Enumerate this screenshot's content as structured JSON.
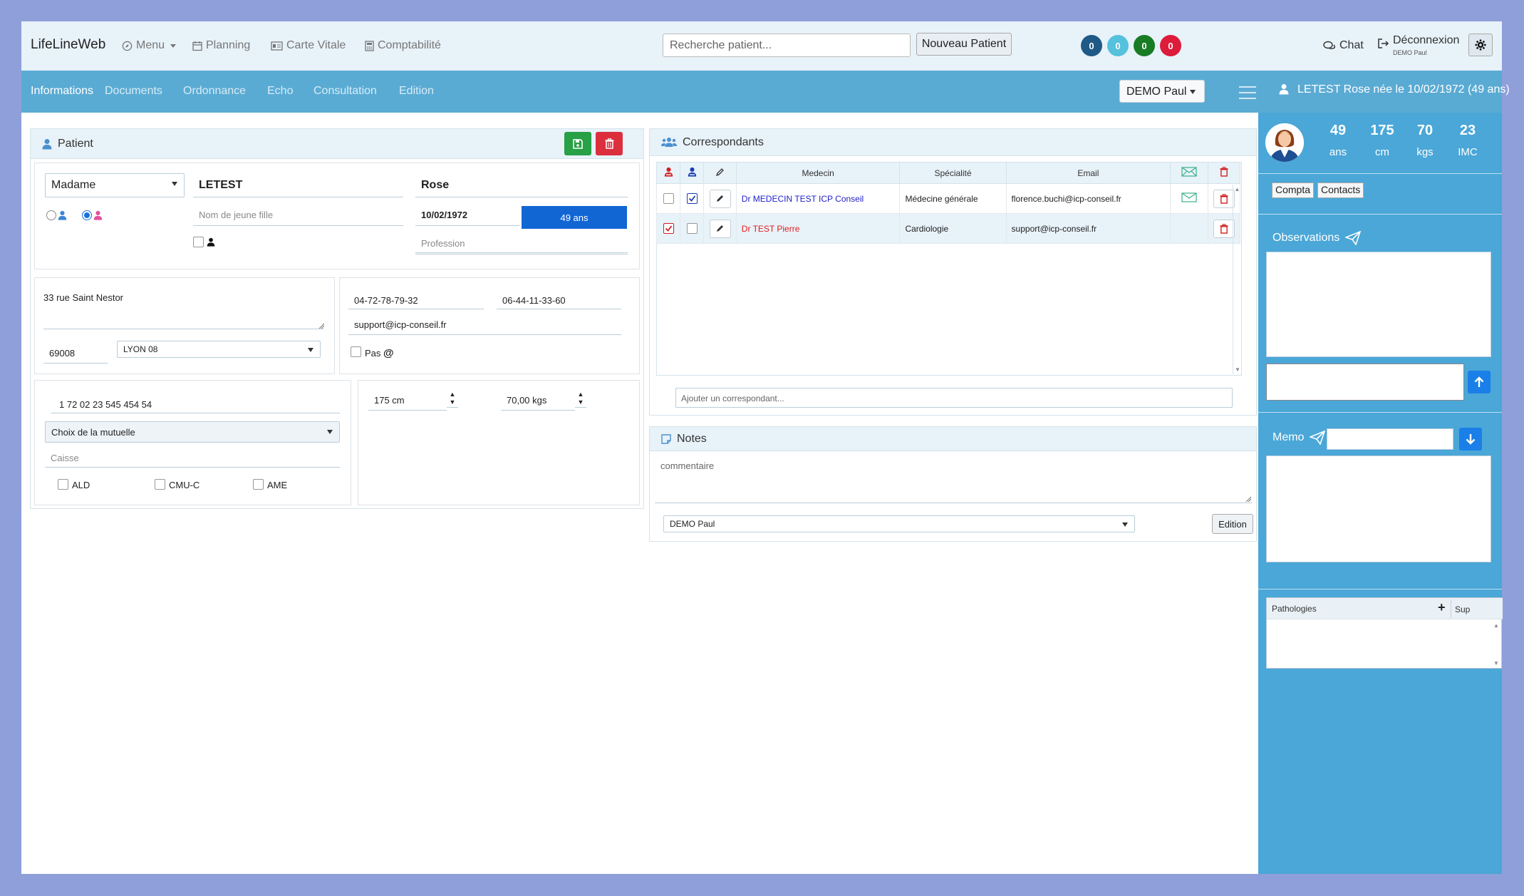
{
  "app": {
    "brand": "LifeLineWeb"
  },
  "topnav": {
    "menu": "Menu",
    "planning": "Planning",
    "carte_vitale": "Carte Vitale",
    "comptabilite": "Comptabilité",
    "search_placeholder": "Recherche patient...",
    "new_patient": "Nouveau Patient",
    "badges": [
      {
        "value": "0",
        "color": "#1f5a87"
      },
      {
        "value": "0",
        "color": "#55c1dd"
      },
      {
        "value": "0",
        "color": "#187c24"
      },
      {
        "value": "0",
        "color": "#dd1b3a"
      }
    ],
    "chat": "Chat",
    "logout": "Déconnexion",
    "logout_user": "DEMO Paul"
  },
  "tabs": [
    "Informations",
    "Documents",
    "Ordonnance",
    "Echo",
    "Consultation",
    "Edition"
  ],
  "doctor_select": "DEMO Paul",
  "patient_header": "LETEST Rose née le 10/02/1972 (49 ans)",
  "patient_panel": {
    "title": "Patient",
    "civility": "Madame",
    "last_name": "LETEST",
    "first_name": "Rose",
    "maiden_name_placeholder": "Nom de jeune fille",
    "birth_date": "10/02/1972",
    "age": "49 ans",
    "profession_placeholder": "Profession",
    "address": "33 rue Saint Nestor",
    "postal_code": "69008",
    "city": "LYON 08",
    "phone1": "04-72-78-79-32",
    "phone2": "06-44-11-33-60",
    "email": "support@icp-conseil.fr",
    "no_email_label": "Pas",
    "at_symbol": "@",
    "ssn": "1 72 02 23 545 454 54",
    "mutuelle": "Choix de la mutuelle",
    "caisse_placeholder": "Caisse",
    "flags": [
      "ALD",
      "CMU-C",
      "AME"
    ],
    "height": "175 cm",
    "weight": "70,00 kgs"
  },
  "correspondants": {
    "title": "Correspondants",
    "columns": [
      "Medecin",
      "Spécialité",
      "Email"
    ],
    "rows": [
      {
        "name": "Dr MEDECIN TEST ICP Conseil",
        "specialty": "Médecine générale",
        "email": "florence.buchi@icp-conseil.fr",
        "color": "#2222cc"
      },
      {
        "name": "Dr TEST Pierre",
        "specialty": "Cardiologie",
        "email": "support@icp-conseil.fr",
        "color": "#e02020"
      }
    ],
    "add_placeholder": "Ajouter un correspondant..."
  },
  "notes": {
    "title": "Notes",
    "comment_placeholder": "commentaire",
    "doctor": "DEMO Paul",
    "edition_button": "Edition"
  },
  "sidebar": {
    "stats": [
      {
        "value": "49",
        "unit": "ans"
      },
      {
        "value": "175",
        "unit": "cm"
      },
      {
        "value": "70",
        "unit": "kgs"
      },
      {
        "value": "23",
        "unit": "IMC"
      }
    ],
    "compta": "Compta",
    "contacts": "Contacts",
    "observations": "Observations",
    "memo": "Memo",
    "pathologies": "Pathologies",
    "sup": "Sup"
  }
}
